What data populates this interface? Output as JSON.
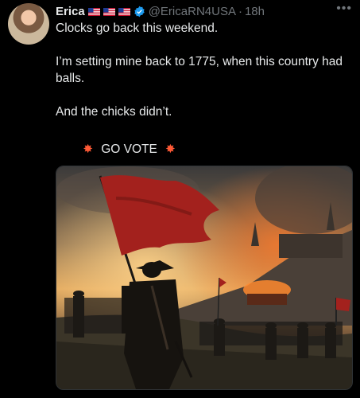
{
  "post": {
    "author_name": "Erica",
    "handle": "@EricaRN4USA",
    "separator": "·",
    "time": "18h",
    "more_icon": "more-options-icon",
    "line1": "Clocks go back this weekend.",
    "line2": "I’m setting mine back to 1775, when this country had balls.",
    "line3": "And the chicks didn’t.",
    "vote_text": "GO VOTE",
    "vote_sparkle_icon": "collision-sparkle-icon",
    "flags_icon": "us-flag-icon",
    "verified_icon": "verified-badge-icon",
    "verified_color": "#1d9bf0"
  },
  "image": {
    "description_icon": "revolutionary-battle-painting",
    "flag_color": "#a3211d"
  }
}
